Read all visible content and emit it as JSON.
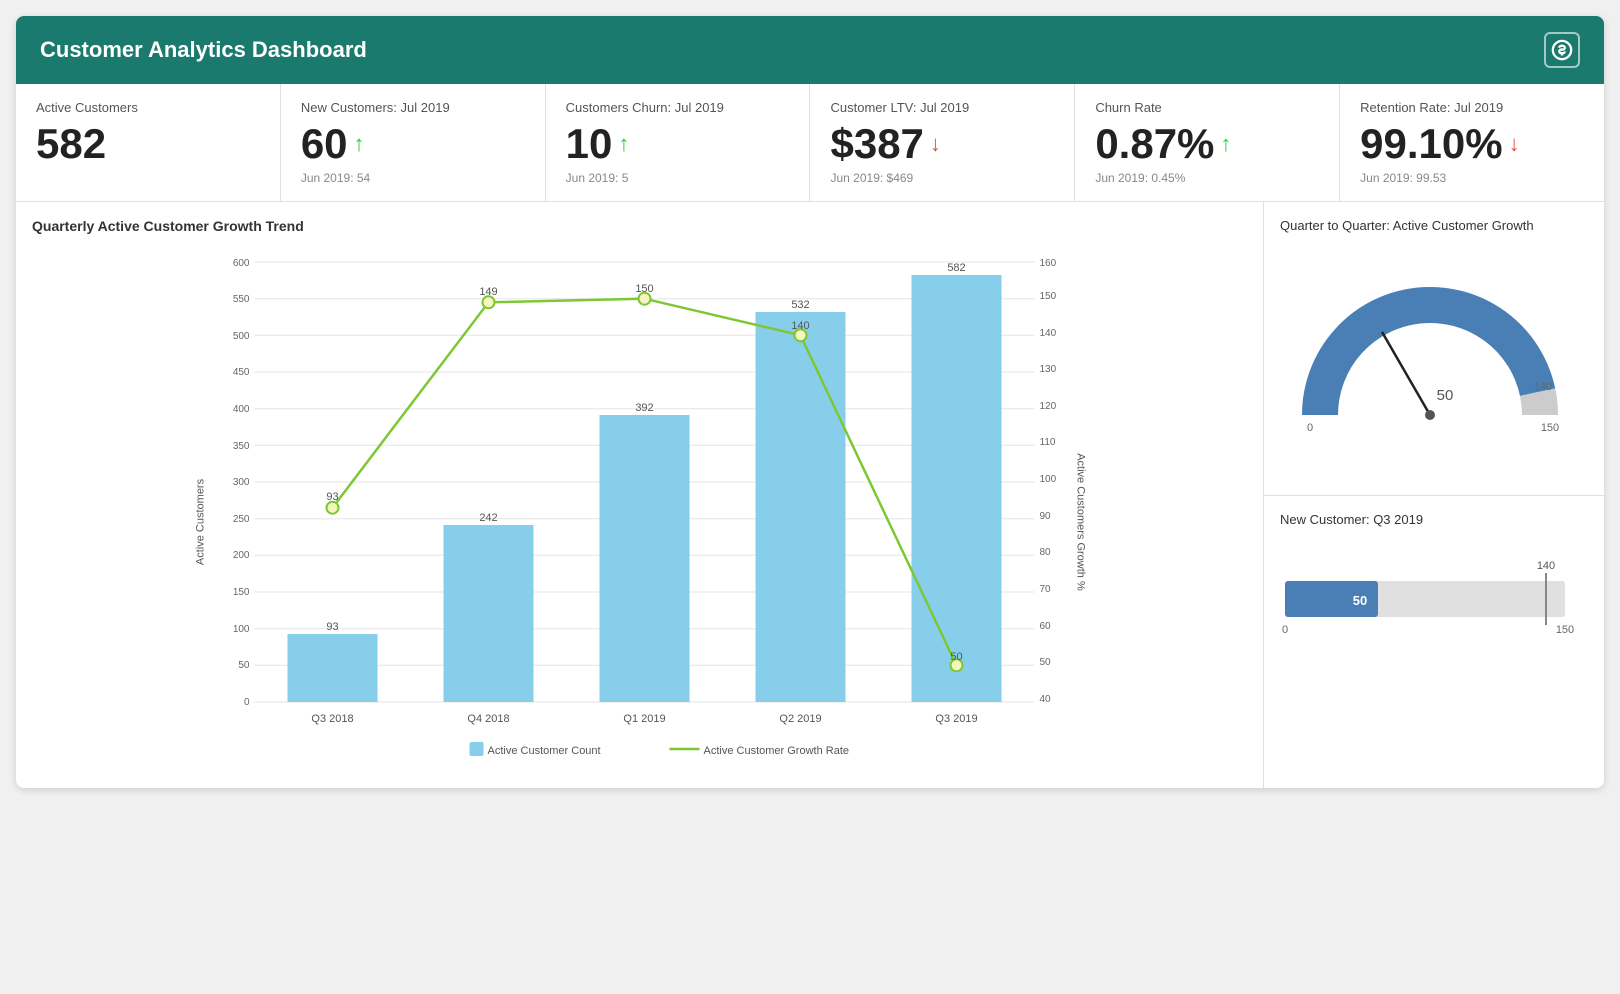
{
  "header": {
    "title": "Customer Analytics Dashboard",
    "icon": "💲"
  },
  "kpis": [
    {
      "label": "Active Customers",
      "value": "582",
      "arrow": null,
      "sub": null
    },
    {
      "label": "New Customers: Jul 2019",
      "value": "60",
      "arrow": "up",
      "sub": "Jun 2019: 54"
    },
    {
      "label": "Customers Churn: Jul 2019",
      "value": "10",
      "arrow": "up",
      "sub": "Jun 2019: 5"
    },
    {
      "label": "Customer LTV: Jul 2019",
      "value": "$387",
      "arrow": "down",
      "sub": "Jun 2019: $469"
    },
    {
      "label": "Churn Rate",
      "value": "0.87%",
      "arrow": "up",
      "sub": "Jun 2019: 0.45%"
    },
    {
      "label": "Retention Rate: Jul 2019",
      "value": "99.10%",
      "arrow": "down",
      "sub": "Jun 2019: 99.53"
    }
  ],
  "barChart": {
    "title": "Quarterly Active Customer Growth Trend",
    "yLeft": {
      "title": "Active Customers",
      "ticks": [
        "600",
        "550",
        "500",
        "450",
        "400",
        "350",
        "300",
        "250",
        "200",
        "150",
        "100",
        "50",
        "0"
      ]
    },
    "yRight": {
      "title": "Active Customers Growth %",
      "ticks": [
        "160",
        "150",
        "140",
        "130",
        "120",
        "110",
        "100",
        "90",
        "80",
        "70",
        "60",
        "50",
        "40"
      ]
    },
    "bars": [
      {
        "quarter": "Q3 2018",
        "count": 93,
        "growth": 93
      },
      {
        "quarter": "Q4 2018",
        "count": 242,
        "growth": 149
      },
      {
        "quarter": "Q1 2019",
        "count": 392,
        "growth": 150
      },
      {
        "quarter": "Q2 2019",
        "count": 532,
        "growth": 140
      },
      {
        "quarter": "Q3 2019",
        "count": 582,
        "growth": 50
      }
    ],
    "legend": {
      "bar": "Active Customer Count",
      "line": "Active Customer Growth Rate"
    }
  },
  "gauge": {
    "title": "Quarter to Quarter: Active Customer Growth",
    "value": 50,
    "min": 0,
    "max": 150,
    "marker": 140
  },
  "horizontalBar": {
    "title": "New Customer: Q3 2019",
    "value": 50,
    "min": 0,
    "max": 150,
    "marker": 140,
    "label": "50"
  }
}
